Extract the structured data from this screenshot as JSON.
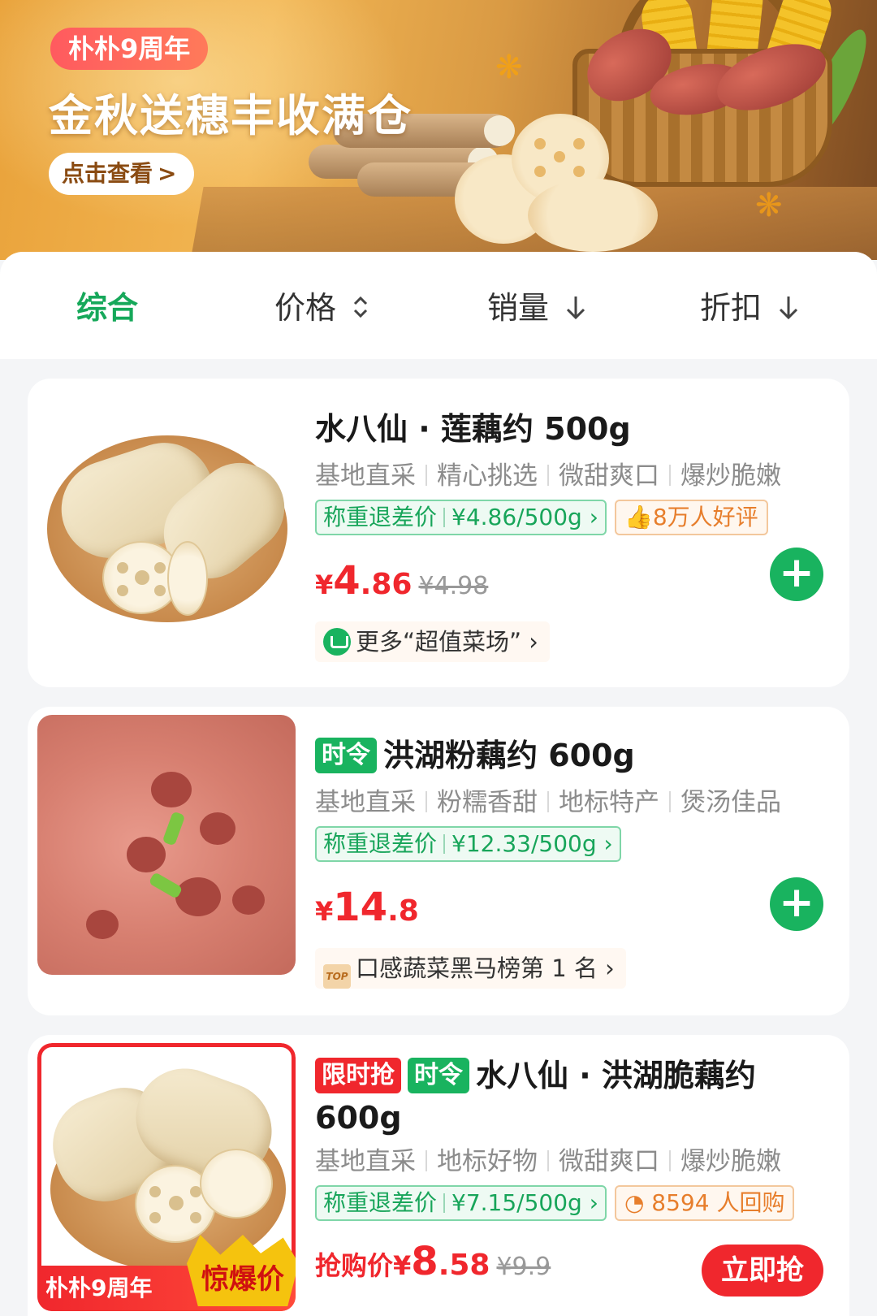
{
  "banner": {
    "badge": "朴朴9周年",
    "title": "金秋送穗丰收满仓",
    "button_label": "点击查看",
    "chevron": ">"
  },
  "sort_bar": {
    "tabs": [
      {
        "label": "综合",
        "active": true,
        "icon": ""
      },
      {
        "label": "价格",
        "active": false,
        "icon": "sort-updown-icon"
      },
      {
        "label": "销量",
        "active": false,
        "icon": "arrow-down-icon"
      },
      {
        "label": "折扣",
        "active": false,
        "icon": "arrow-down-icon"
      }
    ]
  },
  "products": [
    {
      "title": "水八仙 · 莲藕约 500g",
      "tags": [],
      "features": [
        "基地直采",
        "精心挑选",
        "微甜爽口",
        "爆炒脆嫩"
      ],
      "weigh_label": "称重退差价",
      "weigh_price": "¥4.86/500g",
      "social_proof": "8万人好评",
      "price_yen": "¥",
      "price_int": "4",
      "price_dec": ".86",
      "old_price": "¥4.98",
      "promo": "更多“超值菜场”",
      "action": "add"
    },
    {
      "title": "洪湖粉藕约 600g",
      "tags": [
        "时令"
      ],
      "features": [
        "基地直采",
        "粉糯香甜",
        "地标特产",
        "煲汤佳品"
      ],
      "weigh_label": "称重退差价",
      "weigh_price": "¥12.33/500g",
      "social_proof": "",
      "price_yen": "¥",
      "price_int": "14",
      "price_dec": ".8",
      "old_price": "",
      "promo_icon_text": "TOP",
      "promo": "口感蔬菜黑马榜第 1 名",
      "action": "add"
    },
    {
      "title_line1": "水八仙 · 洪湖脆藕约",
      "title_line2": "600g",
      "flash_tag": "限时抢",
      "season_tag": "时令",
      "features": [
        "基地直采",
        "地标好物",
        "微甜爽口",
        "爆炒脆嫩"
      ],
      "weigh_label": "称重退差价",
      "weigh_price": "¥7.15/500g",
      "social_proof": "8594 人回购",
      "price_label": "抢购价",
      "price_yen": "¥",
      "price_int": "8",
      "price_dec": ".58",
      "old_price": "¥9.9",
      "image_ribbon": "朴朴9周年",
      "image_burst": "惊爆价",
      "action_label": "立即抢"
    }
  ],
  "colors": {
    "accent_green": "#19b35f",
    "price_red": "#f0272d",
    "banner_orange": "#e9a23a"
  }
}
